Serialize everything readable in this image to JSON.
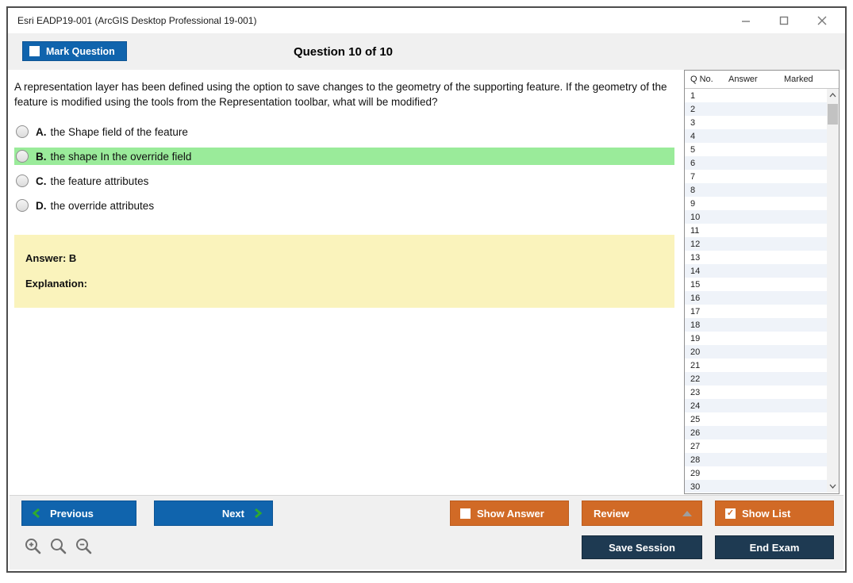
{
  "window": {
    "title": "Esri EADP19-001 (ArcGIS Desktop Professional 19-001)"
  },
  "header": {
    "mark_button_label": "Mark Question",
    "question_counter": "Question 10 of 10"
  },
  "question": {
    "text": "A representation layer has been defined using the option to save changes to the geometry of the supporting feature. If the geometry of the feature is modified using the tools from the Representation toolbar, what will be modified?",
    "options": [
      {
        "letter": "A.",
        "text": "the Shape field of the feature",
        "highlighted": false
      },
      {
        "letter": "B.",
        "text": "the shape In the override field",
        "highlighted": true
      },
      {
        "letter": "C.",
        "text": "the feature attributes",
        "highlighted": false
      },
      {
        "letter": "D.",
        "text": "the override attributes",
        "highlighted": false
      }
    ]
  },
  "answer_box": {
    "answer_line": "Answer: B",
    "explanation_line": "Explanation:"
  },
  "question_list": {
    "headers": {
      "qno": "Q No.",
      "answer": "Answer",
      "marked": "Marked"
    },
    "rows": [
      {
        "q": "1",
        "answer": "",
        "marked": ""
      },
      {
        "q": "2",
        "answer": "",
        "marked": ""
      },
      {
        "q": "3",
        "answer": "",
        "marked": ""
      },
      {
        "q": "4",
        "answer": "",
        "marked": ""
      },
      {
        "q": "5",
        "answer": "",
        "marked": ""
      },
      {
        "q": "6",
        "answer": "",
        "marked": ""
      },
      {
        "q": "7",
        "answer": "",
        "marked": ""
      },
      {
        "q": "8",
        "answer": "",
        "marked": ""
      },
      {
        "q": "9",
        "answer": "",
        "marked": ""
      },
      {
        "q": "10",
        "answer": "",
        "marked": ""
      },
      {
        "q": "11",
        "answer": "",
        "marked": ""
      },
      {
        "q": "12",
        "answer": "",
        "marked": ""
      },
      {
        "q": "13",
        "answer": "",
        "marked": ""
      },
      {
        "q": "14",
        "answer": "",
        "marked": ""
      },
      {
        "q": "15",
        "answer": "",
        "marked": ""
      },
      {
        "q": "16",
        "answer": "",
        "marked": ""
      },
      {
        "q": "17",
        "answer": "",
        "marked": ""
      },
      {
        "q": "18",
        "answer": "",
        "marked": ""
      },
      {
        "q": "19",
        "answer": "",
        "marked": ""
      },
      {
        "q": "20",
        "answer": "",
        "marked": ""
      },
      {
        "q": "21",
        "answer": "",
        "marked": ""
      },
      {
        "q": "22",
        "answer": "",
        "marked": ""
      },
      {
        "q": "23",
        "answer": "",
        "marked": ""
      },
      {
        "q": "24",
        "answer": "",
        "marked": ""
      },
      {
        "q": "25",
        "answer": "",
        "marked": ""
      },
      {
        "q": "26",
        "answer": "",
        "marked": ""
      },
      {
        "q": "27",
        "answer": "",
        "marked": ""
      },
      {
        "q": "28",
        "answer": "",
        "marked": ""
      },
      {
        "q": "29",
        "answer": "",
        "marked": ""
      },
      {
        "q": "30",
        "answer": "",
        "marked": ""
      }
    ]
  },
  "footer": {
    "previous_label": "Previous",
    "next_label": "Next",
    "show_answer_label": "Show Answer",
    "review_label": "Review",
    "show_list_label": "Show List",
    "save_session_label": "Save Session",
    "end_exam_label": "End Exam"
  },
  "icons": {
    "show_list_check": "✓"
  },
  "colors": {
    "primary_blue": "#1064AD",
    "accent_orange": "#D16A26",
    "dark_navy": "#1E3A52",
    "highlight_green": "#9AEB9A",
    "answer_yellow": "#FAF3BC",
    "row_stripe_blue": "#EFF3F9",
    "chevron_green": "#2FAA2F"
  }
}
